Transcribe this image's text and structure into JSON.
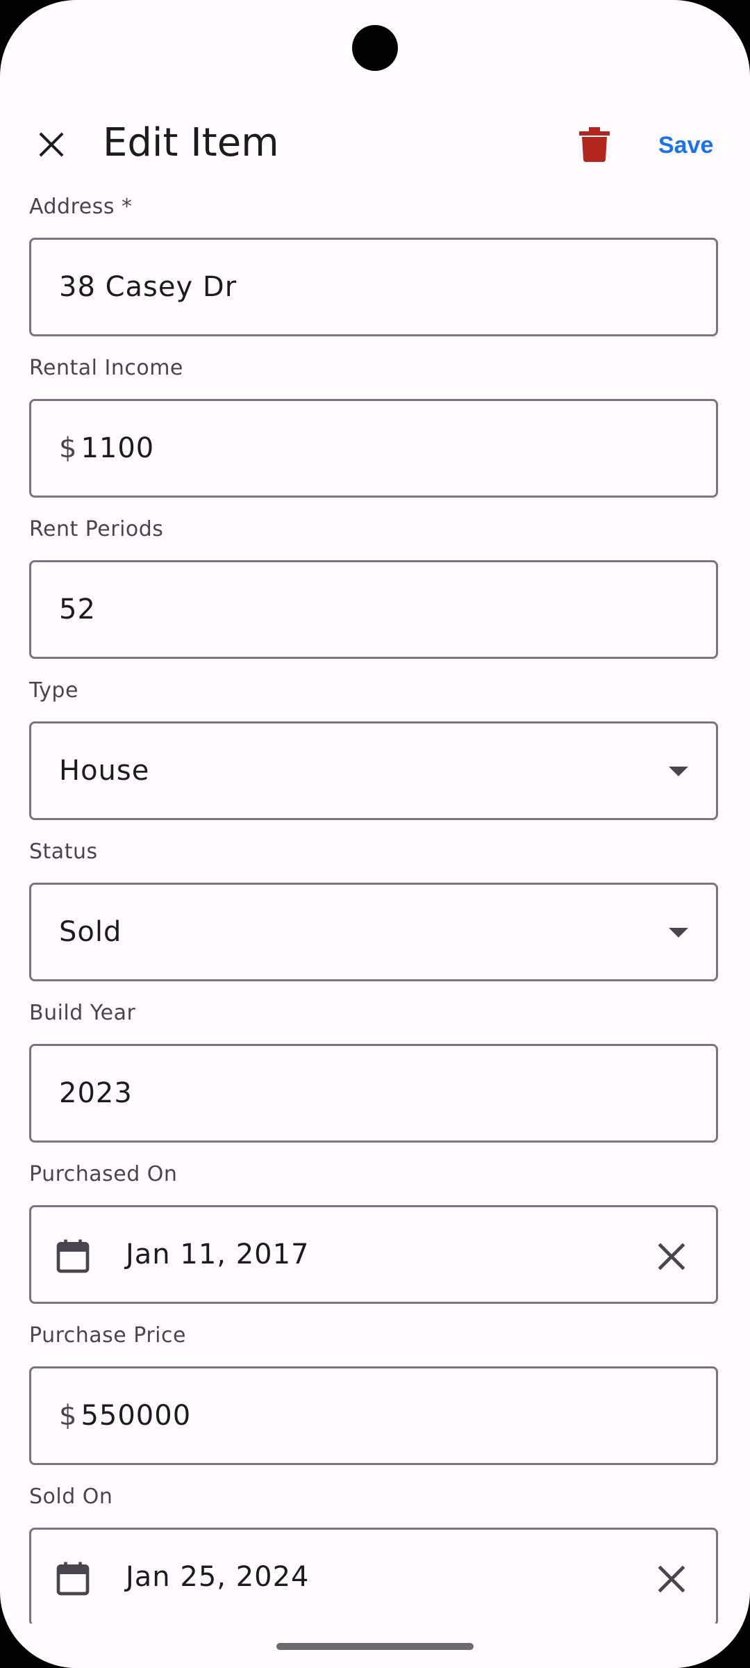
{
  "app_bar": {
    "title": "Edit Item",
    "close_icon": "close-icon",
    "delete_icon": "trash-icon",
    "save_label": "Save"
  },
  "colors": {
    "background": "#fffbfe",
    "outline": "#79747e",
    "accent": "#1a73e8",
    "delete": "#b3261e",
    "text": "#1c1b1f"
  },
  "fields": {
    "address": {
      "label": "Address *",
      "value": "38 Casey Dr"
    },
    "rental_income": {
      "label": "Rental Income",
      "prefix": "$",
      "value": "1100"
    },
    "rent_periods": {
      "label": "Rent Periods",
      "value": "52"
    },
    "type": {
      "label": "Type",
      "value": "House"
    },
    "status": {
      "label": "Status",
      "value": "Sold"
    },
    "build_year": {
      "label": "Build Year",
      "value": "2023"
    },
    "purchased_on": {
      "label": "Purchased On",
      "value": "Jan 11, 2017"
    },
    "purchase_price": {
      "label": "Purchase Price",
      "prefix": "$",
      "value": "550000"
    },
    "sold_on": {
      "label": "Sold On",
      "value": "Jan 25, 2024"
    }
  }
}
